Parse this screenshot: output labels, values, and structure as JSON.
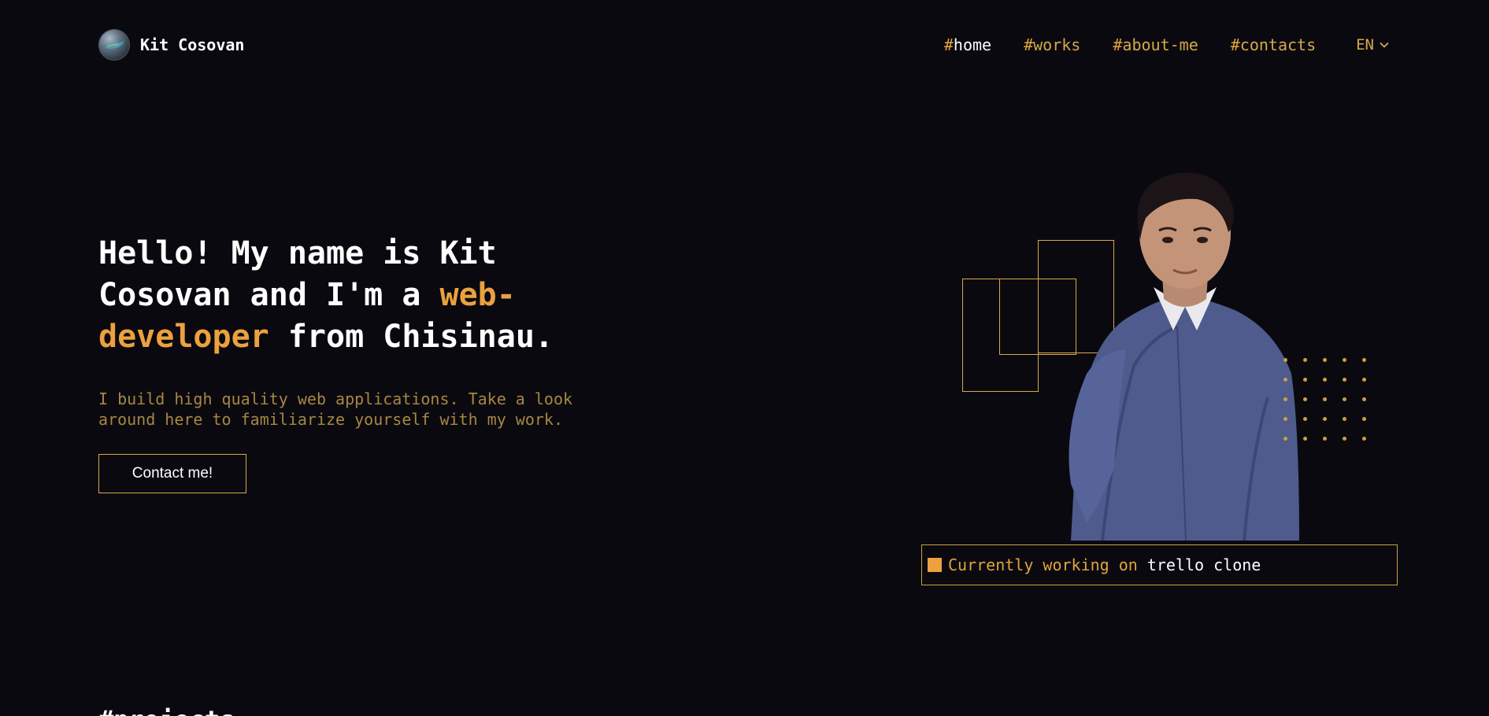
{
  "brand": {
    "name": "Kit Cosovan",
    "logo_icon": "avatar-logo-icon"
  },
  "nav": {
    "items": [
      {
        "hash": "#",
        "label": "home",
        "active": true
      },
      {
        "hash": "#",
        "label": "works",
        "active": false
      },
      {
        "hash": "#",
        "label": "about-me",
        "active": false
      },
      {
        "hash": "#",
        "label": "contacts",
        "active": false
      }
    ],
    "language": "EN",
    "language_icon": "chevron-down-icon"
  },
  "hero": {
    "title_part1": "Hello! My name is Kit Cosovan and I'm a ",
    "title_accent": "web-developer",
    "title_part2": " from Chisinau.",
    "subtitle": "I build high quality web applications. Take a look around here to familiarize yourself with my work.",
    "cta_label": "Contact me!"
  },
  "status": {
    "text": "Currently working on",
    "project": "trello clone"
  },
  "next_section": {
    "heading": "#projects"
  },
  "colors": {
    "background": "#0b0910",
    "accent": "#eba13e",
    "gold": "#d9a84a",
    "muted": "#a58840",
    "text": "#ffffff"
  }
}
